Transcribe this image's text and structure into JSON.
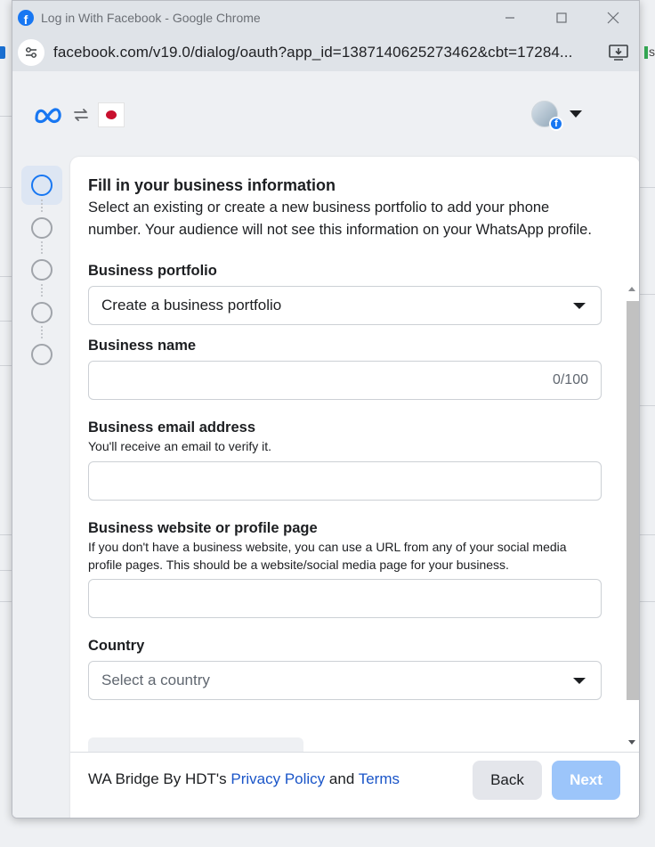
{
  "window": {
    "title": "Log in With Facebook - Google Chrome",
    "url": "facebook.com/v19.0/dialog/oauth?app_id=1387140625273462&cbt=17284..."
  },
  "background_page": {
    "right_edge_text": "s"
  },
  "form": {
    "title": "Fill in your business information",
    "description": "Select an existing or create a new business portfolio to add your phone number. Your audience will not see this information on your WhatsApp profile.",
    "business_portfolio": {
      "label": "Business portfolio",
      "value": "Create a business portfolio"
    },
    "business_name": {
      "label": "Business name",
      "value": "",
      "counter": "0/100"
    },
    "business_email": {
      "label": "Business email address",
      "help": "You'll receive an email to verify it.",
      "value": ""
    },
    "business_website": {
      "label": "Business website or profile page",
      "help": "If you don't have a business website, you can use a URL from any of your social media profile pages. This should be a website/social media page for your business.",
      "value": ""
    },
    "country": {
      "label": "Country",
      "placeholder": "Select a country"
    }
  },
  "stepper": {
    "total_steps": 5,
    "active_step": 1
  },
  "footer": {
    "prefix": "WA Bridge By HDT's ",
    "privacy_link": "Privacy Policy",
    "and": " and ",
    "terms_link": "Terms",
    "back_label": "Back",
    "next_label": "Next"
  },
  "icons": [
    "facebook-favicon",
    "site-info-icon",
    "install-app-icon",
    "meta-logo",
    "sync-icon",
    "app-logo",
    "account-avatar",
    "chevron-down-icon"
  ],
  "colors": {
    "facebook_blue": "#1877f2",
    "link_blue": "#1a55c8",
    "next_disabled": "#9cc5fa",
    "back_bg": "#e4e6eb"
  }
}
